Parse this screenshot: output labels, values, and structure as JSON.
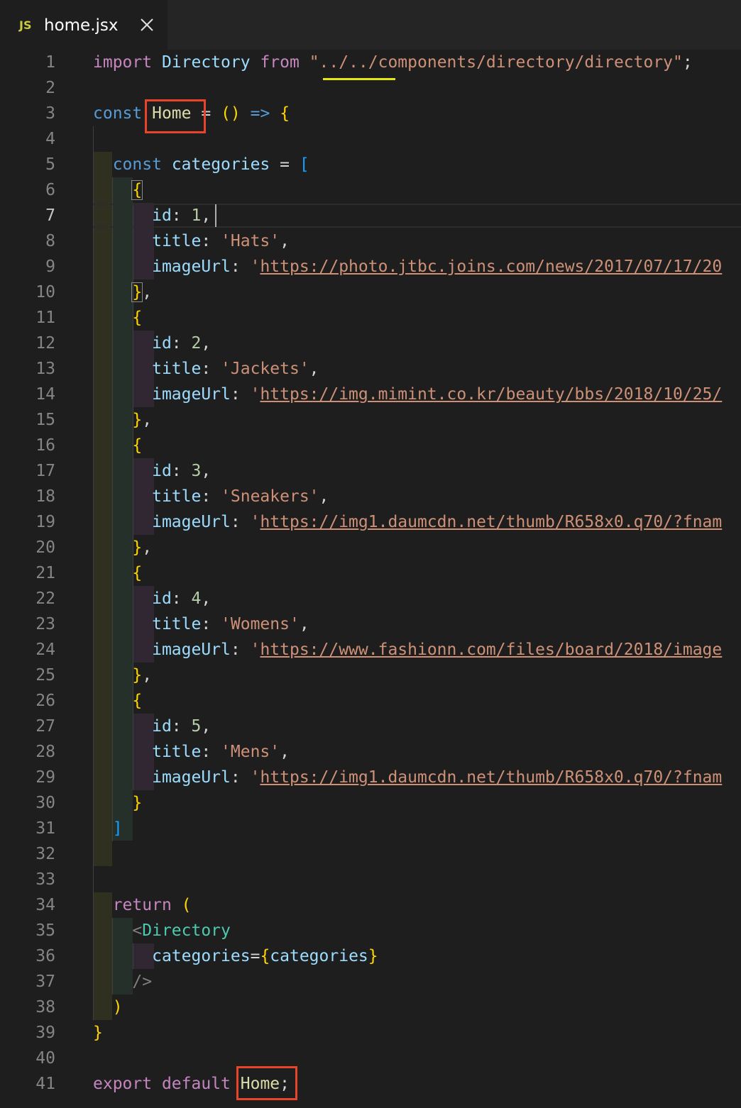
{
  "tab": {
    "icon_label": "JS",
    "file_name": "home.jsx",
    "close_icon": "close-icon"
  },
  "editor": {
    "active_line": 7,
    "lines": [
      {
        "n": 1,
        "tokens": [
          [
            "import",
            "ctl"
          ],
          [
            " ",
            "p"
          ],
          [
            "Directory",
            "var"
          ],
          [
            " ",
            "p"
          ],
          [
            "from",
            "ctl"
          ],
          [
            " ",
            "p"
          ],
          [
            "\"../../components/directory/directory\"",
            "str"
          ],
          [
            ";",
            "p"
          ]
        ]
      },
      {
        "n": 2,
        "tokens": []
      },
      {
        "n": 3,
        "tokens": [
          [
            "const",
            "kw"
          ],
          [
            " ",
            "p"
          ],
          [
            "Home",
            "fn"
          ],
          [
            " ",
            "p"
          ],
          [
            "=",
            "p"
          ],
          [
            " ",
            "p"
          ],
          [
            "()",
            "y"
          ],
          [
            " ",
            "p"
          ],
          [
            "=>",
            "kw"
          ],
          [
            " ",
            "p"
          ],
          [
            "{",
            "y"
          ]
        ]
      },
      {
        "n": 4,
        "tokens": []
      },
      {
        "n": 5,
        "tokens": [
          [
            "  ",
            "p"
          ],
          [
            "const",
            "kw"
          ],
          [
            " ",
            "p"
          ],
          [
            "categories",
            "var"
          ],
          [
            " ",
            "p"
          ],
          [
            "=",
            "p"
          ],
          [
            " ",
            "p"
          ],
          [
            "[",
            "bl"
          ]
        ]
      },
      {
        "n": 6,
        "tokens": [
          [
            "    ",
            "p"
          ],
          [
            "{",
            "y"
          ]
        ]
      },
      {
        "n": 7,
        "tokens": [
          [
            "      ",
            "p"
          ],
          [
            "id",
            "var"
          ],
          [
            ": ",
            "p"
          ],
          [
            "1",
            "num"
          ],
          [
            ",",
            "p"
          ]
        ]
      },
      {
        "n": 8,
        "tokens": [
          [
            "      ",
            "p"
          ],
          [
            "title",
            "var"
          ],
          [
            ": ",
            "p"
          ],
          [
            "'Hats'",
            "str"
          ],
          [
            ",",
            "p"
          ]
        ]
      },
      {
        "n": 9,
        "tokens": [
          [
            "      ",
            "p"
          ],
          [
            "imageUrl",
            "var"
          ],
          [
            ": ",
            "p"
          ],
          [
            "'",
            "str"
          ],
          [
            "https://photo.jtbc.joins.com/news/2017/07/17/20",
            "url"
          ]
        ]
      },
      {
        "n": 10,
        "tokens": [
          [
            "    ",
            "p"
          ],
          [
            "}",
            "y"
          ],
          [
            ",",
            "p"
          ]
        ]
      },
      {
        "n": 11,
        "tokens": [
          [
            "    ",
            "p"
          ],
          [
            "{",
            "y"
          ]
        ]
      },
      {
        "n": 12,
        "tokens": [
          [
            "      ",
            "p"
          ],
          [
            "id",
            "var"
          ],
          [
            ": ",
            "p"
          ],
          [
            "2",
            "num"
          ],
          [
            ",",
            "p"
          ]
        ]
      },
      {
        "n": 13,
        "tokens": [
          [
            "      ",
            "p"
          ],
          [
            "title",
            "var"
          ],
          [
            ": ",
            "p"
          ],
          [
            "'Jackets'",
            "str"
          ],
          [
            ",",
            "p"
          ]
        ]
      },
      {
        "n": 14,
        "tokens": [
          [
            "      ",
            "p"
          ],
          [
            "imageUrl",
            "var"
          ],
          [
            ": ",
            "p"
          ],
          [
            "'",
            "str"
          ],
          [
            "https://img.mimint.co.kr/beauty/bbs/2018/10/25/",
            "url"
          ]
        ]
      },
      {
        "n": 15,
        "tokens": [
          [
            "    ",
            "p"
          ],
          [
            "}",
            "y"
          ],
          [
            ",",
            "p"
          ]
        ]
      },
      {
        "n": 16,
        "tokens": [
          [
            "    ",
            "p"
          ],
          [
            "{",
            "y"
          ]
        ]
      },
      {
        "n": 17,
        "tokens": [
          [
            "      ",
            "p"
          ],
          [
            "id",
            "var"
          ],
          [
            ": ",
            "p"
          ],
          [
            "3",
            "num"
          ],
          [
            ",",
            "p"
          ]
        ]
      },
      {
        "n": 18,
        "tokens": [
          [
            "      ",
            "p"
          ],
          [
            "title",
            "var"
          ],
          [
            ": ",
            "p"
          ],
          [
            "'Sneakers'",
            "str"
          ],
          [
            ",",
            "p"
          ]
        ]
      },
      {
        "n": 19,
        "tokens": [
          [
            "      ",
            "p"
          ],
          [
            "imageUrl",
            "var"
          ],
          [
            ": ",
            "p"
          ],
          [
            "'",
            "str"
          ],
          [
            "https://img1.daumcdn.net/thumb/R658x0.q70/?fnam",
            "url"
          ]
        ]
      },
      {
        "n": 20,
        "tokens": [
          [
            "    ",
            "p"
          ],
          [
            "}",
            "y"
          ],
          [
            ",",
            "p"
          ]
        ]
      },
      {
        "n": 21,
        "tokens": [
          [
            "    ",
            "p"
          ],
          [
            "{",
            "y"
          ]
        ]
      },
      {
        "n": 22,
        "tokens": [
          [
            "      ",
            "p"
          ],
          [
            "id",
            "var"
          ],
          [
            ": ",
            "p"
          ],
          [
            "4",
            "num"
          ],
          [
            ",",
            "p"
          ]
        ]
      },
      {
        "n": 23,
        "tokens": [
          [
            "      ",
            "p"
          ],
          [
            "title",
            "var"
          ],
          [
            ": ",
            "p"
          ],
          [
            "'Womens'",
            "str"
          ],
          [
            ",",
            "p"
          ]
        ]
      },
      {
        "n": 24,
        "tokens": [
          [
            "      ",
            "p"
          ],
          [
            "imageUrl",
            "var"
          ],
          [
            ": ",
            "p"
          ],
          [
            "'",
            "str"
          ],
          [
            "https://www.fashionn.com/files/board/2018/image",
            "url"
          ]
        ]
      },
      {
        "n": 25,
        "tokens": [
          [
            "    ",
            "p"
          ],
          [
            "}",
            "y"
          ],
          [
            ",",
            "p"
          ]
        ]
      },
      {
        "n": 26,
        "tokens": [
          [
            "    ",
            "p"
          ],
          [
            "{",
            "y"
          ]
        ]
      },
      {
        "n": 27,
        "tokens": [
          [
            "      ",
            "p"
          ],
          [
            "id",
            "var"
          ],
          [
            ": ",
            "p"
          ],
          [
            "5",
            "num"
          ],
          [
            ",",
            "p"
          ]
        ]
      },
      {
        "n": 28,
        "tokens": [
          [
            "      ",
            "p"
          ],
          [
            "title",
            "var"
          ],
          [
            ": ",
            "p"
          ],
          [
            "'Mens'",
            "str"
          ],
          [
            ",",
            "p"
          ]
        ]
      },
      {
        "n": 29,
        "tokens": [
          [
            "      ",
            "p"
          ],
          [
            "imageUrl",
            "var"
          ],
          [
            ": ",
            "p"
          ],
          [
            "'",
            "str"
          ],
          [
            "https://img1.daumcdn.net/thumb/R658x0.q70/?fnam",
            "url"
          ]
        ]
      },
      {
        "n": 30,
        "tokens": [
          [
            "    ",
            "p"
          ],
          [
            "}",
            "y"
          ]
        ]
      },
      {
        "n": 31,
        "tokens": [
          [
            "  ",
            "p"
          ],
          [
            "]",
            "bl"
          ]
        ]
      },
      {
        "n": 32,
        "tokens": []
      },
      {
        "n": 33,
        "tokens": []
      },
      {
        "n": 34,
        "tokens": [
          [
            "  ",
            "p"
          ],
          [
            "return",
            "ctl"
          ],
          [
            " ",
            "p"
          ],
          [
            "(",
            "y"
          ]
        ]
      },
      {
        "n": 35,
        "tokens": [
          [
            "    ",
            "p"
          ],
          [
            "<",
            "gray"
          ],
          [
            "Directory",
            "cls"
          ]
        ]
      },
      {
        "n": 36,
        "tokens": [
          [
            "      ",
            "p"
          ],
          [
            "categories",
            "var"
          ],
          [
            "=",
            "p"
          ],
          [
            "{",
            "y"
          ],
          [
            "categories",
            "var"
          ],
          [
            "}",
            "y"
          ]
        ]
      },
      {
        "n": 37,
        "tokens": [
          [
            "    ",
            "p"
          ],
          [
            "/>",
            "gray"
          ]
        ]
      },
      {
        "n": 38,
        "tokens": [
          [
            "  ",
            "p"
          ],
          [
            ")",
            "y"
          ]
        ]
      },
      {
        "n": 39,
        "tokens": [
          [
            "}",
            "y"
          ]
        ]
      },
      {
        "n": 40,
        "tokens": []
      },
      {
        "n": 41,
        "tokens": [
          [
            "export",
            "ctl"
          ],
          [
            " ",
            "p"
          ],
          [
            "default",
            "ctl"
          ],
          [
            " ",
            "p"
          ],
          [
            "Home",
            "fn"
          ],
          [
            ";",
            "p"
          ]
        ]
      }
    ]
  },
  "colors": {
    "background": "#1e1e1e",
    "tab_bar": "#252526",
    "highlight_box": "#e9442a",
    "keyword": "#569cd6",
    "control": "#c586c0",
    "function": "#dcdcaa",
    "variable": "#9cdcfe",
    "component": "#4ec9b0",
    "string": "#ce9178",
    "number": "#b5cea8"
  }
}
